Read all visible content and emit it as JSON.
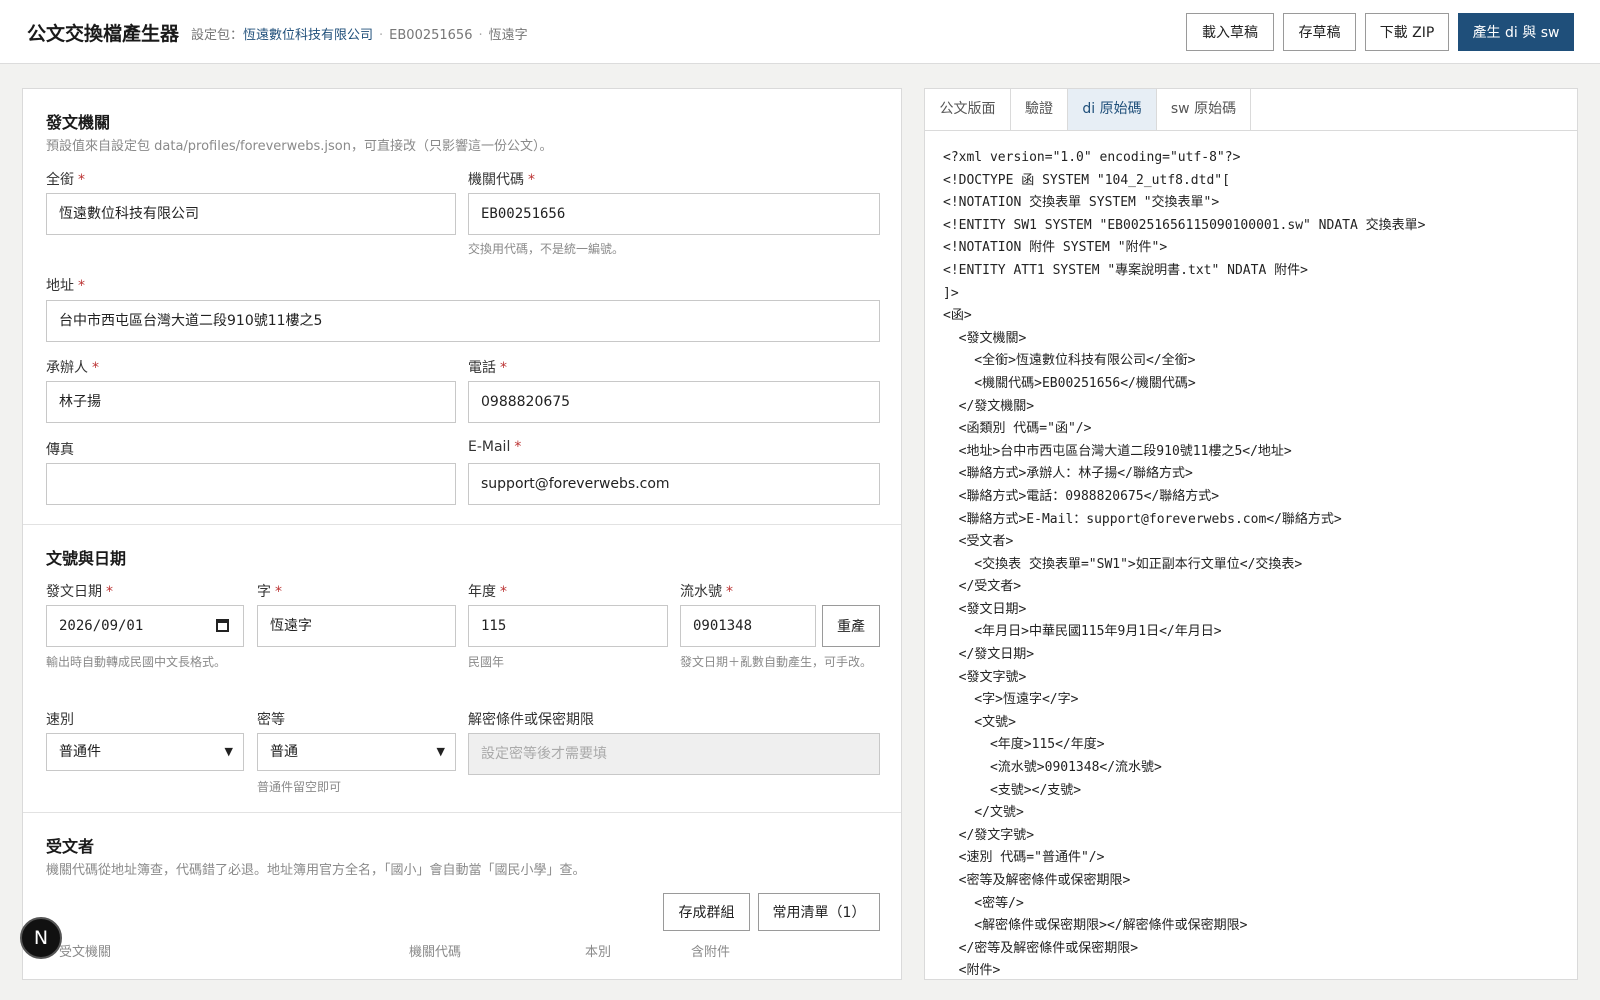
{
  "header": {
    "title": "公文交換檔產生器",
    "profile_prefix": "設定包：",
    "profile_name": "恆遠數位科技有限公司",
    "sep1": "·",
    "org_code": "EB00251656",
    "sep2": "·",
    "word": "恆遠字",
    "buttons": {
      "load_draft": "載入草稿",
      "save_draft": "存草稿",
      "download_zip": "下載 ZIP",
      "generate": "產生 di 與 sw"
    }
  },
  "sender": {
    "title": "發文機關",
    "desc": "預設值來自設定包 data/profiles/foreverwebs.json，可直接改（只影響這一份公文）。",
    "full_name_label": "全銜",
    "full_name_value": "恆遠數位科技有限公司",
    "org_code_label": "機關代碼",
    "org_code_value": "EB00251656",
    "org_code_hint": "交換用代碼，不是統一編號。",
    "address_label": "地址",
    "address_value": "台中市西屯區台灣大道二段910號11樓之5",
    "contact_label": "承辦人",
    "contact_value": "林子揚",
    "phone_label": "電話",
    "phone_value": "0988820675",
    "fax_label": "傳真",
    "fax_value": "",
    "email_label": "E-Mail",
    "email_value": "support@foreverwebs.com",
    "required_mark": "*"
  },
  "numbering": {
    "title": "文號與日期",
    "date_label": "發文日期",
    "date_value": "2026/09/01",
    "date_hint": "輸出時自動轉成民國中文長格式。",
    "word_label": "字",
    "word_value": "恆遠字",
    "year_label": "年度",
    "year_value": "115",
    "year_hint": "民國年",
    "serial_label": "流水號",
    "serial_value": "0901348",
    "regen_button": "重產",
    "serial_hint": "發文日期＋亂數自動產生，可手改。",
    "speed_label": "速別",
    "speed_value": "普通件",
    "secrecy_label": "密等",
    "secrecy_value": "普通",
    "secrecy_hint": "普通件留空即可",
    "declass_label": "解密條件或保密期限",
    "declass_placeholder": "設定密等後才需要填"
  },
  "recipients": {
    "title": "受文者",
    "desc": "機關代碼從地址簿查，代碼錯了必退。地址簿用官方全名，「國小」會自動當「國民小學」查。",
    "save_group_button": "存成群組",
    "common_list_button": "常用清單（1）",
    "col_org": "受文機關",
    "col_code": "機關代碼",
    "col_copy": "本別",
    "col_attach": "含附件"
  },
  "right": {
    "tabs": [
      "公文版面",
      "驗證",
      "di 原始碼",
      "sw 原始碼"
    ],
    "active_tab": 2,
    "code_lines": [
      "<?xml version=\"1.0\" encoding=\"utf-8\"?>",
      "<!DOCTYPE 函 SYSTEM \"104_2_utf8.dtd\"[",
      "<!NOTATION 交換表單 SYSTEM \"交換表單\">",
      "<!ENTITY SW1 SYSTEM \"EB00251656115090100001.sw\" NDATA 交換表單>",
      "<!NOTATION 附件 SYSTEM \"附件\">",
      "<!ENTITY ATT1 SYSTEM \"專案說明書.txt\" NDATA 附件>",
      "]>",
      "<函>",
      "  <發文機關>",
      "    <全銜>恆遠數位科技有限公司</全銜>",
      "    <機關代碼>EB00251656</機關代碼>",
      "  </發文機關>",
      "  <函類別 代碼=\"函\"/>",
      "  <地址>台中市西屯區台灣大道二段910號11樓之5</地址>",
      "  <聯絡方式>承辦人：林子揚</聯絡方式>",
      "  <聯絡方式>電話：0988820675</聯絡方式>",
      "  <聯絡方式>E-Mail：support@foreverwebs.com</聯絡方式>",
      "  <受文者>",
      "    <交換表 交換表單=\"SW1\">如正副本行文單位</交換表>",
      "  </受文者>",
      "  <發文日期>",
      "    <年月日>中華民國115年9月1日</年月日>",
      "  </發文日期>",
      "  <發文字號>",
      "    <字>恆遠字</字>",
      "    <文號>",
      "      <年度>115</年度>",
      "      <流水號>0901348</流水號>",
      "      <支號></支號>",
      "    </文號>",
      "  </發文字號>",
      "  <速別 代碼=\"普通件\"/>",
      "  <密等及解密條件或保密期限>",
      "    <密等/>",
      "    <解密條件或保密期限></解密條件或保密期限>",
      "  </密等及解密條件或保密期限>",
      "  <附件>"
    ]
  },
  "avatar": {
    "letter": "N"
  }
}
